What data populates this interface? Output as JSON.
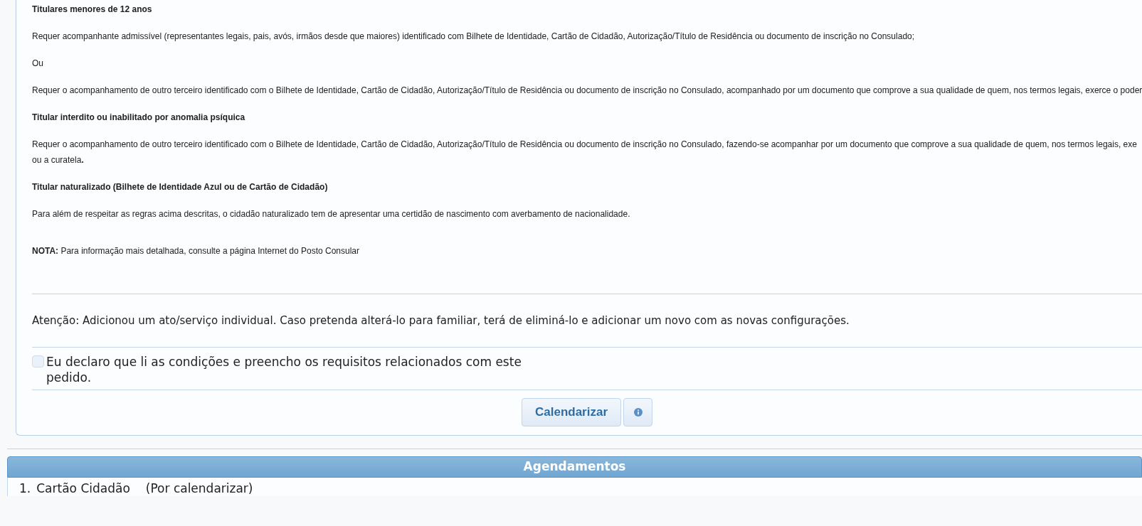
{
  "sections": [
    {
      "kind": "heading",
      "text": "Titulares menores de 12 anos"
    },
    {
      "kind": "para",
      "text": "Requer acompanhante admissível (representantes legais, pais, avós, irmãos desde que maiores) identificado com Bilhete de Identidade, Cartão de Cidadão, Autorização/Título de Residência ou documento de inscrição no Consulado;"
    },
    {
      "kind": "para",
      "text": "Ou"
    },
    {
      "kind": "para",
      "text": "Requer o acompanhamento de outro terceiro identificado com o Bilhete de Identidade, Cartão de Cidadão, Autorização/Título de Residência ou documento de inscrição no Consulado, acompanhado por um documento que comprove a sua qualidade de quem, nos termos legais, exerce o poder"
    },
    {
      "kind": "heading",
      "text": "Titular interdito ou inabilitado por anomalia psíquica"
    },
    {
      "kind": "para",
      "text": "Requer o acompanhamento de outro terceiro identificado com o Bilhete de Identidade, Cartão de Cidadão, Autorização/Título de Residência ou documento de inscrição no Consulado, fazendo-se acompanhar por um documento que comprove a sua qualidade de quem, nos termos legais, exe",
      "continuation": "ou a curatela**.**"
    },
    {
      "kind": "heading",
      "text": "Titular naturalizado (Bilhete de Identidade Azul ou de Cartão de Cidadão)"
    },
    {
      "kind": "para",
      "text": "Para além de respeitar as regras acima descritas, o cidadão naturalizado tem de apresentar uma certidão de nascimento com averbamento de nacionalidade."
    }
  ],
  "note": "**NOTA:** Para informação mais detalhada, consulte a página Internet do Posto Consular",
  "attention": "Atenção: Adicionou um ato/serviço individual. Caso pretenda alterá-lo para familiar, terá de eliminá-lo e adicionar um novo com as novas configurações.",
  "declaration": {
    "label": "Eu declaro que li as condições e preencho os requisitos relacionados com este pedido.",
    "checked": false
  },
  "buttons": {
    "schedule": "Calendarizar"
  },
  "appointments": {
    "title": "Agendamentos",
    "items": [
      {
        "number": "1.",
        "service": "Cartão Cidadão",
        "status": "(Por calendarizar)"
      }
    ]
  }
}
